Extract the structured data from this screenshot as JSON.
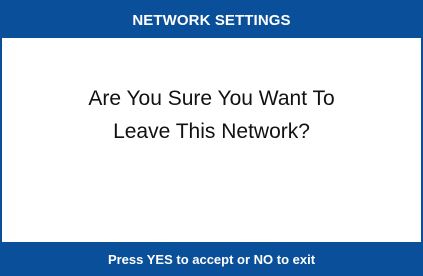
{
  "dialog": {
    "title": "NETWORK SETTINGS",
    "message_line_1": "Are You Sure You Want To",
    "message_line_2": "Leave This Network?",
    "footer_hint": "Press YES to accept or NO to exit"
  },
  "colors": {
    "header_bg": "#0a4f99",
    "footer_bg": "#0a4f99",
    "body_bg": "#ffffff",
    "text_light": "#ffffff",
    "text_dark": "#111111"
  }
}
